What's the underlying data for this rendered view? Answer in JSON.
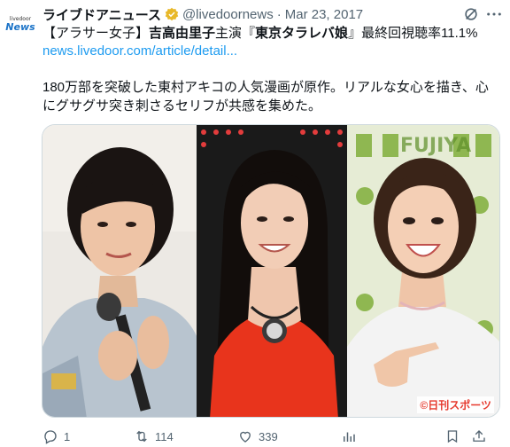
{
  "avatar": {
    "small_text": "livedoor",
    "big_text": "News"
  },
  "tweet": {
    "display_name": "ライブドアニュース",
    "handle": "@livedoornews",
    "separator": "·",
    "date": "Mar 23, 2017",
    "headline": {
      "part1": "【アラサー女子】",
      "part2": "吉高由里子",
      "part3": "主演『",
      "part4": "東京タラレバ娘",
      "part5": "』最終回視聴率11.1%"
    },
    "link": "news.livedoor.com/article/detail...",
    "body": "180万部を突破した東村アキコの人気漫画が原作。リアルな女心を描き、心にグサグサ突き刺さるセリフが共感を集めた。"
  },
  "media": {
    "credit": "©日刊スポーツ",
    "background_sign": "FUJIYA"
  },
  "actions": {
    "replies": "1",
    "retweets": "114",
    "likes": "339",
    "views": "",
    "bookmark": ""
  },
  "colors": {
    "accent": "#1d9bf0",
    "gold_badge": "#e8b829",
    "text": "#0f1419",
    "muted": "#536471"
  }
}
